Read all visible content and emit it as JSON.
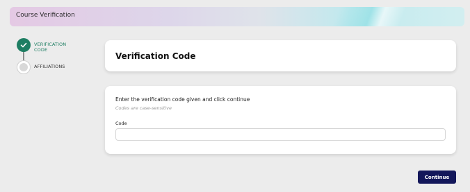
{
  "header": {
    "title": "Course Verification"
  },
  "stepper": {
    "steps": [
      {
        "label": "VERIFICATION CODE",
        "status": "completed"
      },
      {
        "label": "AFFILIATIONS",
        "status": "upcoming"
      }
    ]
  },
  "main": {
    "title": "Verification Code",
    "instruction": "Enter the verification code given and click continue",
    "hint": "Codes are case-sensitive",
    "code_field": {
      "label": "Code",
      "value": "",
      "placeholder": ""
    }
  },
  "actions": {
    "continue_label": "Continue"
  },
  "colors": {
    "accent_green": "#1e7e63",
    "primary_button": "#13175a",
    "background": "#ececec"
  }
}
